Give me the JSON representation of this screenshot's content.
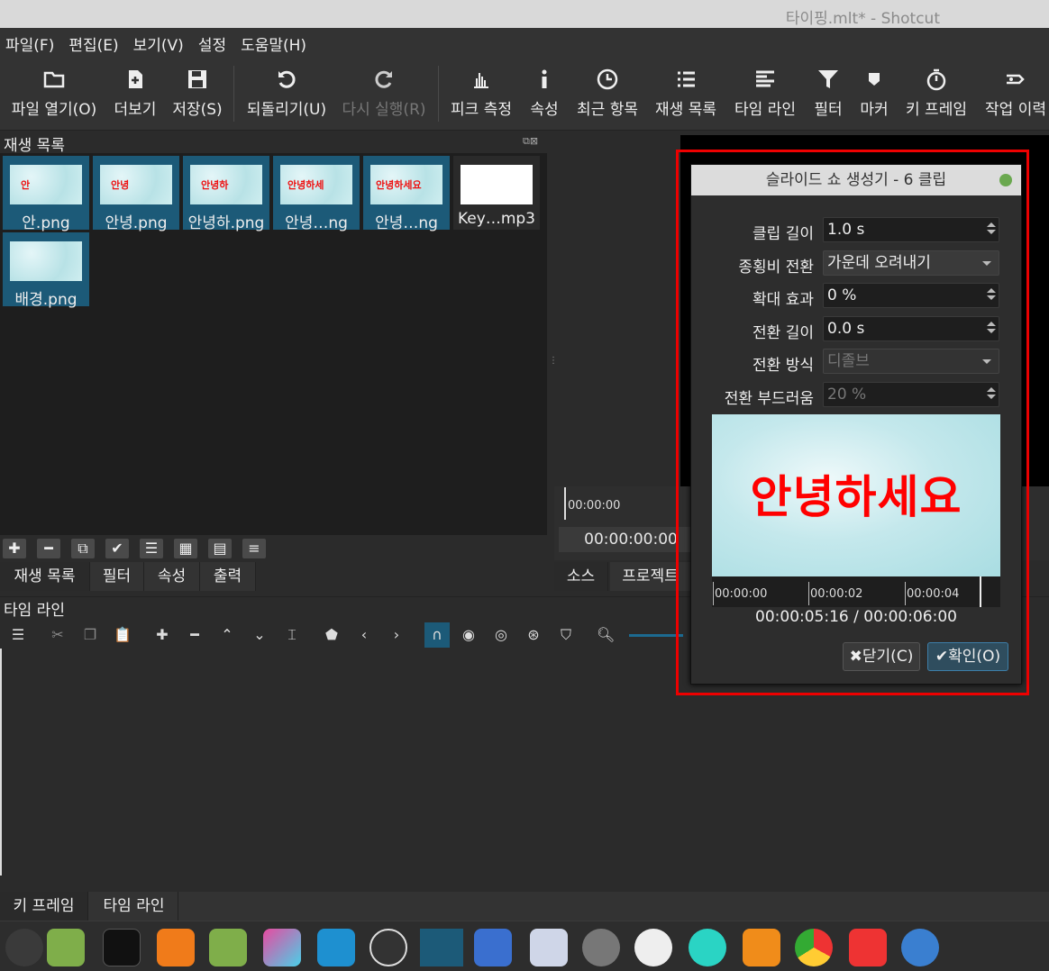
{
  "window": {
    "title": "타이핑.mlt* - Shotcut"
  },
  "menu": [
    "파일(F)",
    "편집(E)",
    "보기(V)",
    "설정",
    "도움말(H)"
  ],
  "toolbar": {
    "open": "파일 열기(O)",
    "more": "더보기",
    "save": "저장(S)",
    "undo": "되돌리기(U)",
    "redo": "다시 실행(R)",
    "peak": "피크 측정",
    "properties": "속성",
    "recent": "최근 항목",
    "playlist": "재생 목록",
    "timeline": "타임 라인",
    "filter": "필터",
    "marker": "마커",
    "keyframes": "키 프레임",
    "jobs": "작업 이력"
  },
  "playlist": {
    "title": "재생 목록",
    "clips": [
      {
        "name": "안.png",
        "thumb_text": "안"
      },
      {
        "name": "안녕.png",
        "thumb_text": "안녕"
      },
      {
        "name": "안녕하.png",
        "thumb_text": "안녕하"
      },
      {
        "name": "안녕…ng",
        "thumb_text": "안녕하세"
      },
      {
        "name": "안녕…ng",
        "thumb_text": "안녕하세요"
      },
      {
        "name": "Key…mp3",
        "thumb_text": ""
      },
      {
        "name": "배경.png",
        "thumb_text": ""
      }
    ],
    "tabs": [
      "재생 목록",
      "필터",
      "속성",
      "출력"
    ]
  },
  "player": {
    "ruler_start": "00:00:00",
    "timecode": "00:00:00:00",
    "tabs": [
      "소스",
      "프로젝트"
    ]
  },
  "timeline": {
    "title": "타임 라인"
  },
  "bottom_tabs": [
    "키 프레임",
    "타임 라인"
  ],
  "dialog": {
    "title": "슬라이드 쇼 생성기 - 6 클립",
    "fields": {
      "clip_length": {
        "label": "클립 길이",
        "value": "1.0 s"
      },
      "aspect": {
        "label": "종횡비 전환",
        "value": "가운데 오려내기"
      },
      "zoom": {
        "label": "확대 효과",
        "value": "0 %"
      },
      "transition_length": {
        "label": "전환 길이",
        "value": "0.0 s"
      },
      "transition_type": {
        "label": "전환 방식",
        "value": "디졸브"
      },
      "softness": {
        "label": "전환 부드러움",
        "value": "20 %"
      }
    },
    "preview_text": "안녕하세요",
    "ruler": [
      "00:00:00",
      "00:00:02",
      "00:00:04"
    ],
    "time": "00:00:05:16 / 00:00:06:00",
    "close": "닫기(C)",
    "ok": "확인(O)"
  },
  "colors": {
    "accent": "#1c5a78",
    "highlight": "#ee0000",
    "preview_text": "#ff0000"
  }
}
